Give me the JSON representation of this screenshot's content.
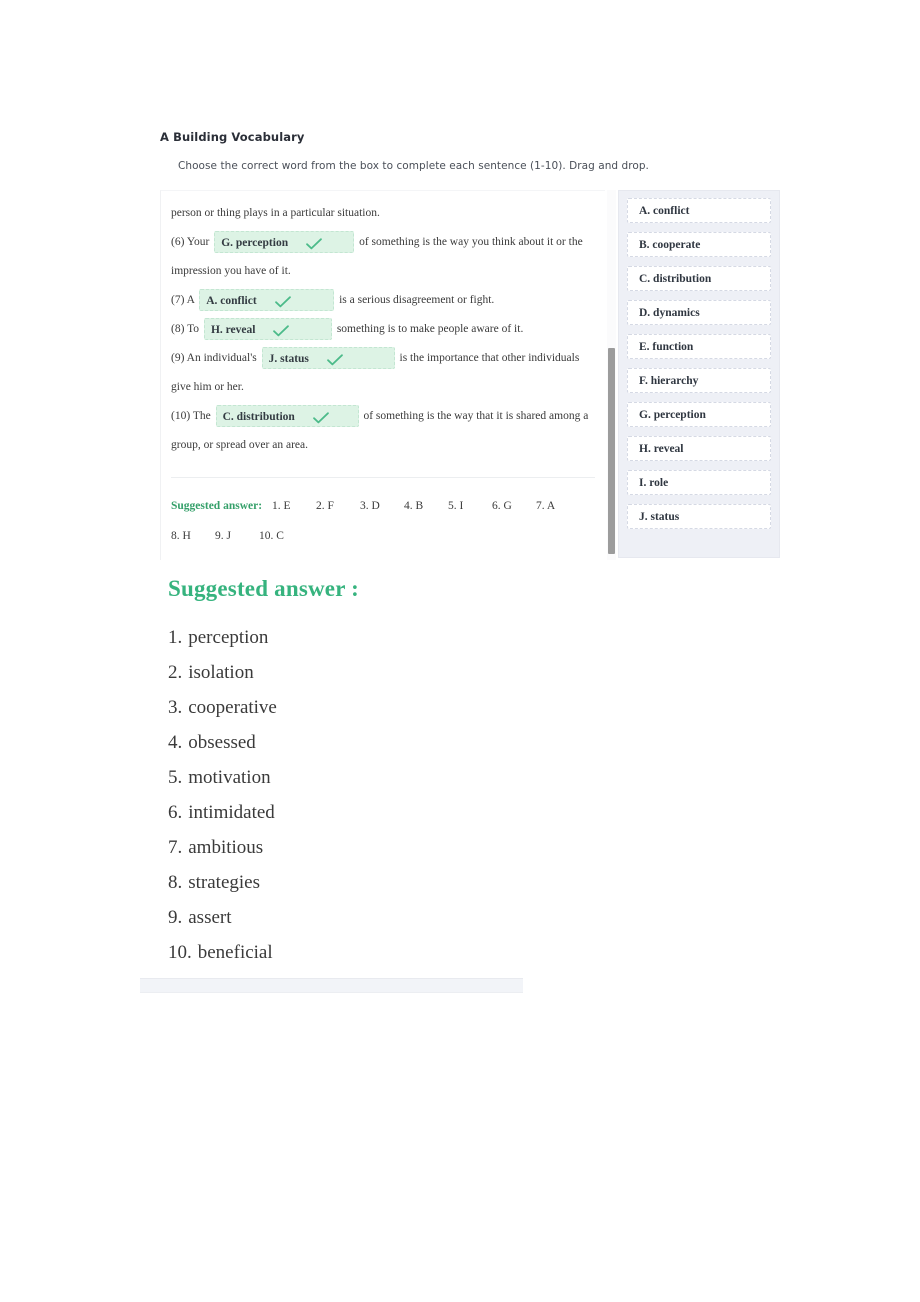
{
  "exercise": {
    "title": "A Building Vocabulary",
    "instructions": "Choose the correct word from the box to complete each sentence (1-10). Drag and drop.",
    "accent_green": "#36b37e",
    "dropzone_bg": "#ddf3e5",
    "bank_bg": "#eef0f6"
  },
  "sentences": {
    "lead_in": "person or thing plays in a particular situation.",
    "q6": {
      "prefix": "(6) Your",
      "answer": "G. perception",
      "suffix": "of something is the way you think about it or the impression you have of it."
    },
    "q7": {
      "prefix": "(7) A",
      "answer": "A. conflict",
      "suffix": "is a serious disagreement or fight."
    },
    "q8": {
      "prefix": "(8) To",
      "answer": "H. reveal",
      "suffix": "something is to make people aware of it."
    },
    "q9": {
      "prefix": "(9) An individual's",
      "answer": "J. status",
      "suffix": "is the importance that other individuals give him or her."
    },
    "q10": {
      "prefix": "(10) The",
      "answer": "C. distribution",
      "suffix": "of something is the way that it is shared among a group, or spread over an area."
    },
    "check_icon": "check-icon"
  },
  "suggested_inline": {
    "label": "Suggested answer:",
    "items": [
      "1. E",
      "2. F",
      "3. D",
      "4. B",
      "5. I",
      "6. G",
      "7. A",
      "8. H",
      "9. J",
      "10. C"
    ]
  },
  "word_bank": {
    "items": [
      "A. conflict",
      "B. cooperate",
      "C. distribution",
      "D. dynamics",
      "E. function",
      "F. hierarchy",
      "G. perception",
      "H. reveal",
      "I. role",
      "J. status"
    ]
  },
  "answer_section": {
    "heading": "Suggested answer :",
    "items": [
      {
        "num": "1.",
        "word": "perception"
      },
      {
        "num": "2.",
        "word": "isolation"
      },
      {
        "num": "3.",
        "word": "cooperative"
      },
      {
        "num": "4.",
        "word": "obsessed"
      },
      {
        "num": "5.",
        "word": "motivation"
      },
      {
        "num": "6.",
        "word": "intimidated"
      },
      {
        "num": "7.",
        "word": "ambitious"
      },
      {
        "num": "8.",
        "word": "strategies"
      },
      {
        "num": "9.",
        "word": "assert"
      },
      {
        "num": "10.",
        "word": "beneficial"
      }
    ]
  }
}
